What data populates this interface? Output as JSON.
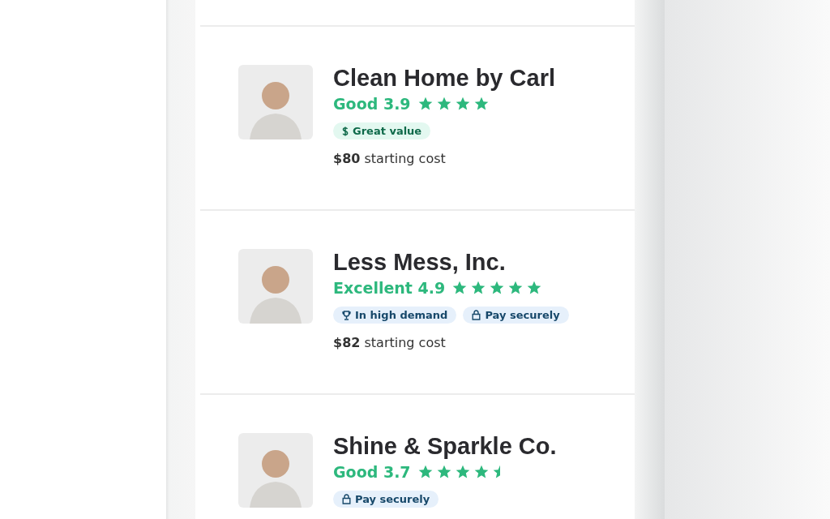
{
  "listings": [
    {
      "name": "Clean Home by Carl",
      "rating_label": "Good 3.9",
      "stars": 4,
      "badges": [
        {
          "kind": "value",
          "label": "Great value"
        }
      ],
      "price": "$80",
      "price_note": "starting cost"
    },
    {
      "name": "Less Mess, Inc.",
      "rating_label": "Excellent 4.9",
      "stars": 5,
      "badges": [
        {
          "kind": "demand",
          "label": "In high demand"
        },
        {
          "kind": "secure",
          "label": "Pay securely"
        }
      ],
      "price": "$82",
      "price_note": "starting cost"
    },
    {
      "name": "Shine & Sparkle Co.",
      "rating_label": "Good 3.7",
      "stars": 4.5,
      "badges": [
        {
          "kind": "secure",
          "label": "Pay securely"
        }
      ]
    }
  ]
}
